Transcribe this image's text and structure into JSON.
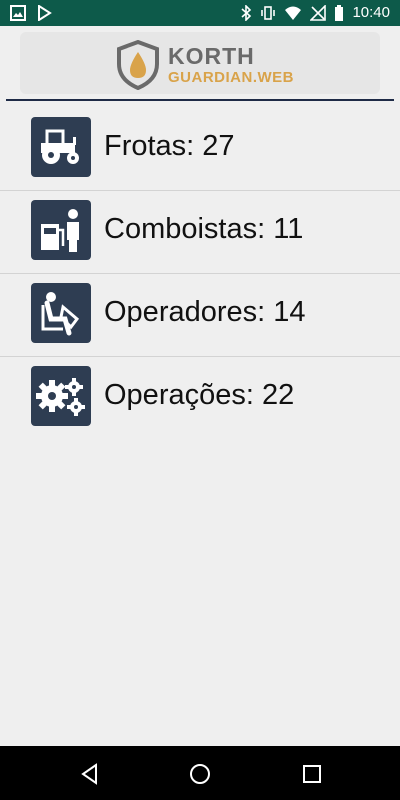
{
  "status_bar": {
    "time": "10:40",
    "left_icons": [
      "image-icon",
      "play-store-icon"
    ],
    "right_icons": [
      "bluetooth-icon",
      "vibrate-icon",
      "wifi-icon",
      "no-signal-icon",
      "battery-icon"
    ]
  },
  "logo": {
    "title": "KORTH",
    "subtitle": "GUARDIAN.WEB",
    "colors": {
      "title": "#6a6a6a",
      "subtitle": "#d9a34a",
      "drop": "#d9a34a",
      "shield": "#6a6a6a"
    }
  },
  "menu": {
    "items": [
      {
        "label": "Frotas: 27",
        "icon": "tractor-icon"
      },
      {
        "label": "Comboistas: 11",
        "icon": "fuel-attendant-icon"
      },
      {
        "label": "Operadores: 14",
        "icon": "operator-seat-icon"
      },
      {
        "label": "Operações: 22",
        "icon": "gears-icon"
      }
    ]
  },
  "nav_bar": {
    "buttons": [
      "back-icon",
      "home-icon",
      "recents-icon"
    ]
  },
  "colors": {
    "status_bar": "#0d5a4a",
    "icon_tile": "#2e3d52",
    "divider": "#1e2a46",
    "background": "#efefef"
  }
}
